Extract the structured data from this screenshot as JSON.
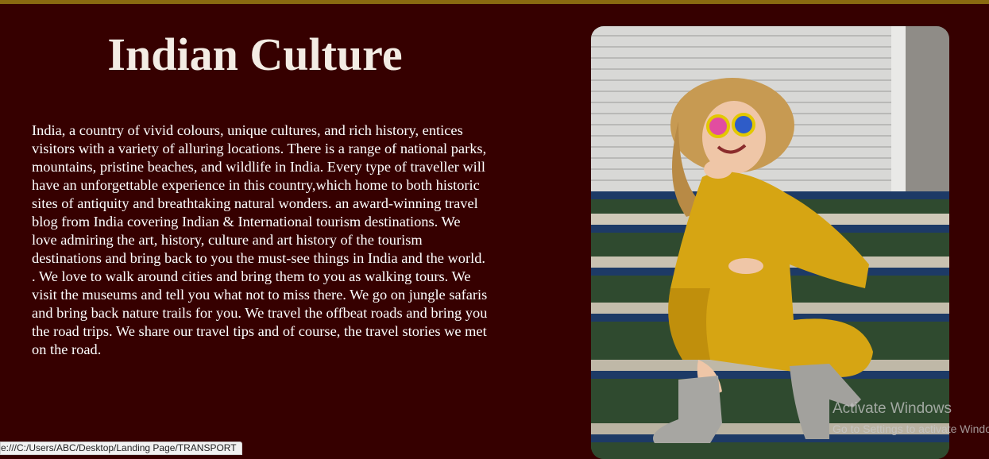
{
  "page": {
    "title": "Indian Culture",
    "paragraph": "India, a country of vivid colours, unique cultures, and rich history, entices visitors with a variety of alluring locations. There is a range of national parks, mountains, pristine beaches, and wildlife in India. Every type of traveller will have an unforgettable experience in this country,which home to both historic sites of antiquity and breathtaking natural wonders. an award-winning travel blog from India covering Indian & International tourism destinations. We love admiring the art, history, culture and art history of the tourism destinations and bring back to you the must-see things in India and the world. . We love to walk around cities and bring them to you as walking tours. We visit the museums and tell you what not to miss there. We go on jungle safaris and bring back nature trails for you. We travel the offbeat roads and bring you the road trips. We share our travel tips and of course, the travel stories we met on the road."
  },
  "status_bar": {
    "url": "e:///C:/Users/ABC/Desktop/Landing Page/TRANSPORT"
  },
  "watermark": {
    "title": "Activate Windows",
    "subtitle": "Go to Settings to activate Windows."
  },
  "colors": {
    "background": "#360000",
    "top_border": "#8a6a10",
    "text": "#ffffff"
  }
}
